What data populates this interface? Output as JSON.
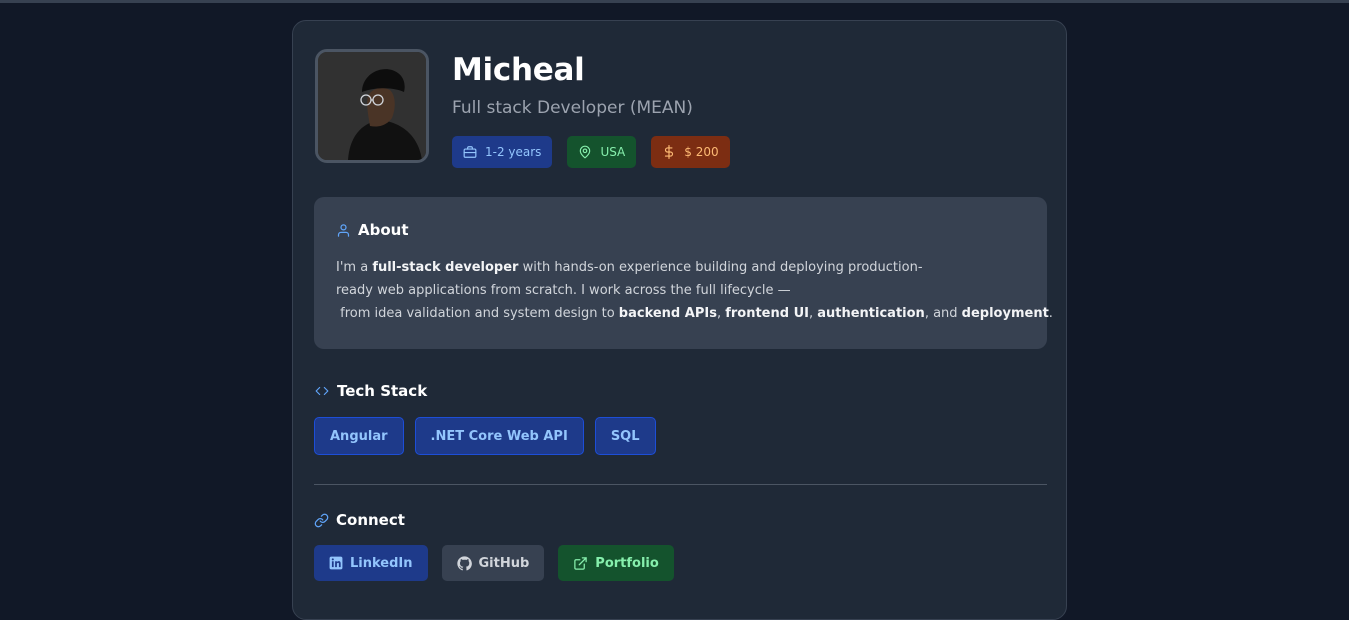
{
  "profile": {
    "name": "Micheal",
    "role": "Full stack Developer (MEAN)",
    "experience": "1-2 years",
    "location": "USA",
    "rate": "$ 200"
  },
  "about": {
    "title": "About",
    "line1_a": "I'm a ",
    "line1_b": "full-stack developer",
    "line1_c": " with hands-on experience building and deploying production-",
    "line2": "ready web applications from scratch. I work across the full lifecycle —",
    "line3_a": " from idea validation and system design to ",
    "line3_b": "backend APIs",
    "line3_c": ", ",
    "line3_d": "frontend UI",
    "line3_e": ", ",
    "line3_f": "authentication",
    "line3_g": ", and ",
    "line3_h": "deployment",
    "line3_i": "."
  },
  "tech": {
    "title": "Tech Stack",
    "items": [
      "Angular",
      ".NET Core Web API",
      "SQL"
    ]
  },
  "connect": {
    "title": "Connect",
    "linkedin": "LinkedIn",
    "github": "GitHub",
    "portfolio": "Portfolio"
  },
  "colors": {
    "background": "#111827",
    "card": "#1f2937",
    "accent_blue": "#60a5fa",
    "badge_blue": "#1e3a8a",
    "badge_green": "#14532d",
    "badge_orange": "#7c2d12"
  },
  "icons": {
    "experience": "briefcase-icon",
    "location": "map-pin-icon",
    "rate": "dollar-icon",
    "about": "user-icon",
    "tech": "code-icon",
    "connect": "link-icon",
    "linkedin": "linkedin-icon",
    "github": "github-icon",
    "portfolio": "external-link-icon"
  }
}
